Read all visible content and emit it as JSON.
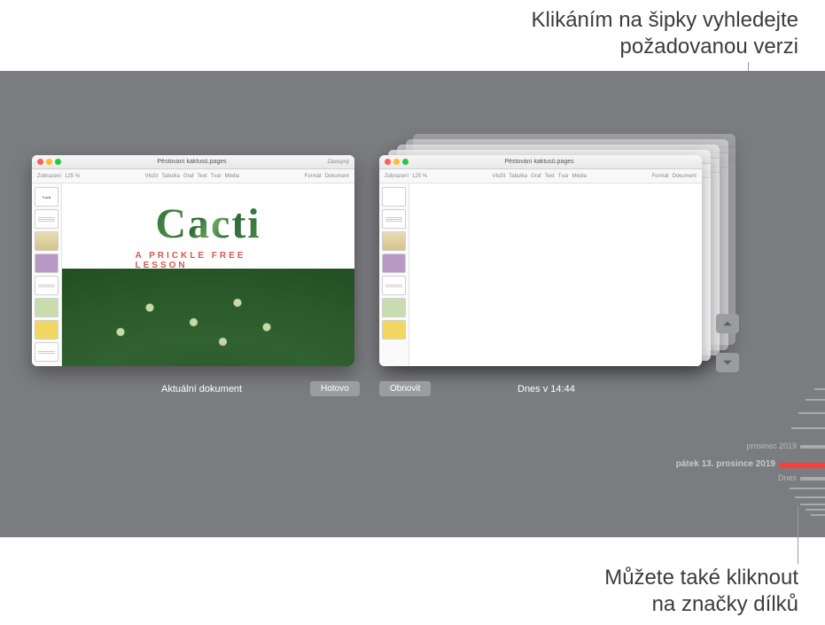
{
  "callouts": {
    "top_line1": "Klikáním na šipky vyhledejte",
    "top_line2": "požadovanou verzi",
    "bottom_line1": "Můžete také kliknout",
    "bottom_line2": "na značky dílků"
  },
  "left_window": {
    "filename": "Pěstování kaktusů.pages",
    "share_label": "Zástupný",
    "page_title": "Cacti",
    "page_subtitle": "A Prickle Free Lesson"
  },
  "right_window": {
    "filename": "Pěstování kaktusů.pages"
  },
  "toolbar_items": {
    "view": "Zobrazení",
    "zoom": "125 %",
    "insert": "Vložit",
    "table": "Tabulka",
    "chart": "Graf",
    "text": "Text",
    "shape": "Tvar",
    "media": "Média",
    "format": "Formát",
    "document": "Dokument"
  },
  "under": {
    "current_label": "Aktuální dokument",
    "done_btn": "Hotovo",
    "restore_btn": "Obnovit",
    "version_time": "Dnes v  14:44"
  },
  "timeline": {
    "month_label": "prosinec 2019",
    "selected_label": "pátek 13. prosince 2019",
    "today_label": "Dnes"
  },
  "thumbs": {
    "t1": "Cacti"
  }
}
